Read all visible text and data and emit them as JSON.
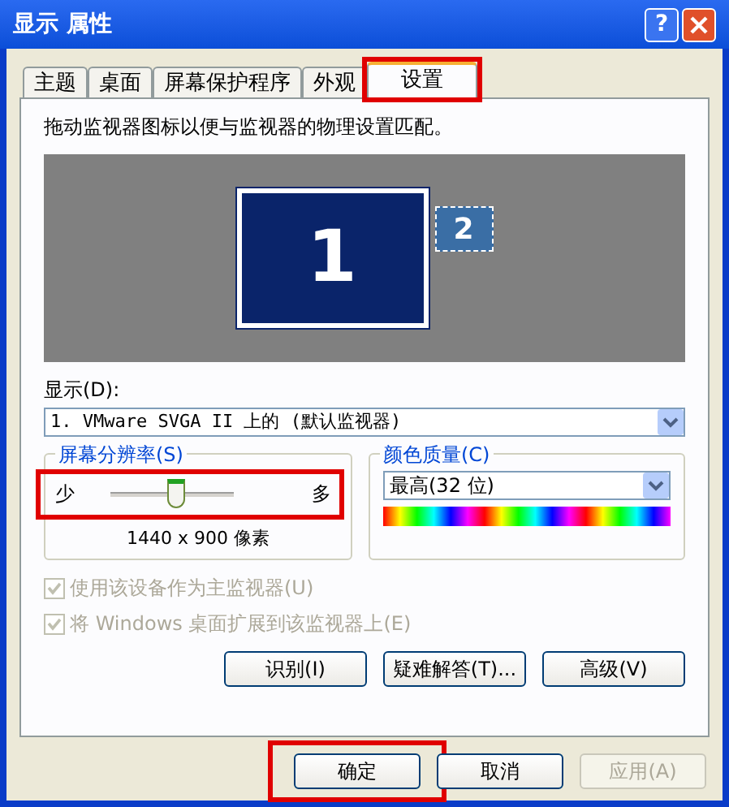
{
  "window": {
    "title": "显示 属性",
    "help_button": "?"
  },
  "tabs": [
    {
      "label": "主题",
      "selected": false,
      "highlighted": false
    },
    {
      "label": "桌面",
      "selected": false,
      "highlighted": false
    },
    {
      "label": "屏幕保护程序",
      "selected": false,
      "highlighted": false
    },
    {
      "label": "外观",
      "selected": false,
      "highlighted": false
    },
    {
      "label": "设置",
      "selected": true,
      "highlighted": true
    }
  ],
  "instruction": "拖动监视器图标以便与监视器的物理设置匹配。",
  "monitors": [
    {
      "label": "1",
      "selected": true
    },
    {
      "label": "2",
      "selected": false
    }
  ],
  "display": {
    "label": "显示(D):",
    "value": "1. VMware SVGA II 上的 (默认监视器)"
  },
  "resolution": {
    "title": "屏幕分辨率(S)",
    "min_label": "少",
    "max_label": "多",
    "level": 0.53,
    "reading": "1440 x 900 像素",
    "highlighted": true
  },
  "color_quality": {
    "title": "颜色质量(C)",
    "value": "最高(32 位)"
  },
  "checkboxes": [
    {
      "label": "使用该设备作为主监视器(U)",
      "checked": true,
      "disabled": true
    },
    {
      "label": "将 Windows 桌面扩展到该监视器上(E)",
      "checked": true,
      "disabled": true
    }
  ],
  "panel_buttons": [
    "识别(I)",
    "疑难解答(T)...",
    "高级(V)"
  ],
  "dialog_buttons": [
    {
      "label": "确定",
      "disabled": false,
      "highlighted": true
    },
    {
      "label": "取消",
      "disabled": false,
      "highlighted": false
    },
    {
      "label": "应用(A)",
      "disabled": true,
      "highlighted": false
    }
  ]
}
